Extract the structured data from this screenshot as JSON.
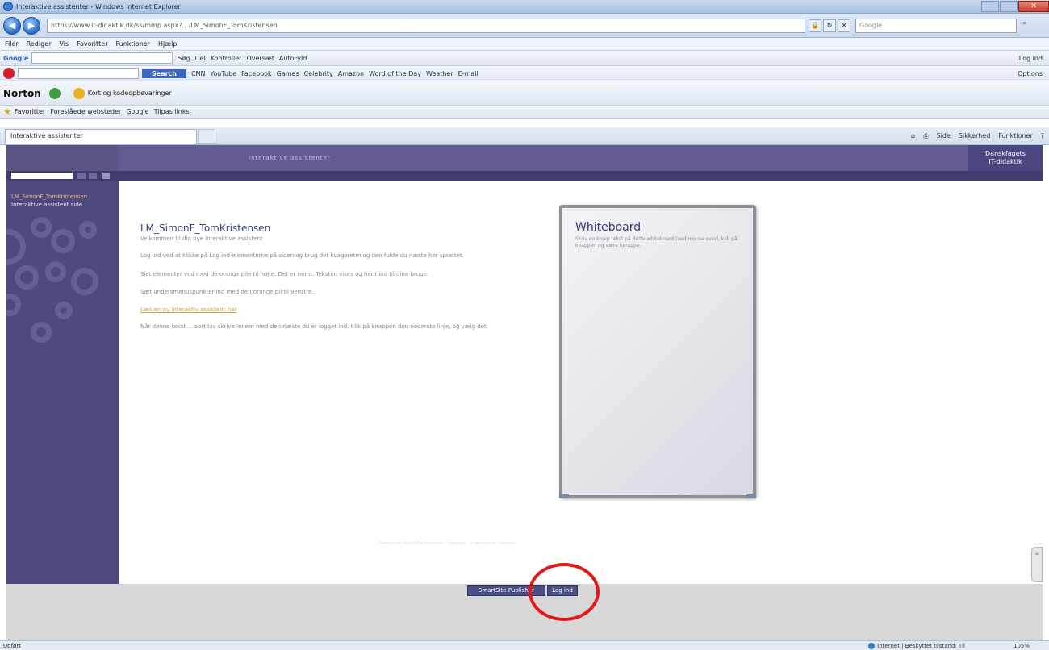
{
  "window": {
    "title": "Interaktive assistenter - Windows Internet Explorer",
    "close_label": "✕"
  },
  "address": {
    "url": "https://www.it-didaktik.dk/ss/mmp.aspx?…/LM_SimonF_TomKristensen",
    "search_placeholder": "Google"
  },
  "menubar": {
    "items": [
      "Filer",
      "Rediger",
      "Vis",
      "Favoritter",
      "Funktioner",
      "Hjælp"
    ]
  },
  "google_toolbar": {
    "logo": "Google",
    "items": [
      "Søg",
      "Del",
      "Kontroller",
      "Oversæt",
      "AutoFyld"
    ],
    "right": "Log ind"
  },
  "ask_toolbar": {
    "search_label": "Search",
    "items": [
      "CNN",
      "YouTube",
      "Facebook",
      "Games",
      "Celebrity",
      "Amazon",
      "Word of the Day",
      "Weather",
      "E-mail"
    ],
    "right": "Options"
  },
  "norton_toolbar": {
    "brand": "Norton",
    "item": "Kort og kodeopbevaringer"
  },
  "favorites_bar": {
    "label": "Favoritter",
    "items": [
      "Foreslåede websteder",
      "Google",
      "Tilpas links"
    ]
  },
  "tabs": {
    "active": "Interaktive assistenter",
    "commands": [
      "Side",
      "Sikkerhed",
      "Funktioner"
    ]
  },
  "page": {
    "banner_crumb": "Interaktive assistenter",
    "brand_line1": "Danskfagets",
    "brand_line2": "IT-didaktik",
    "nav_active": "LM_SimonF_TomKristensen",
    "nav_item2": "Interaktive assistent side",
    "title": "LM_SimonF_TomKristensen",
    "subtitle": "Velkommen til din nye interaktive assistent",
    "paragraphs": [
      "Log ind ved at klikke på Log ind-elementerne på siden og brug det kvageretm og den fulde du næste her sprattet.",
      "Slet elementer ved med de orange pile til højre. Det er nemt. Teksten vises og hent ind til dine bruge.",
      "Sæt undersmenuspunkter ind med den orange pil til venstre."
    ],
    "link": "Læs en ny interaktiv assistent her",
    "closing": "Når denne tekst ... sort lav skrive lenem med den næste du er logget ind. Klik på knappen den nederste linje, og vælg det.",
    "footer_text": "Powered by SmartSite Publisher · Copyright · it-didaktik.dk · Kontakt"
  },
  "whiteboard": {
    "title": "Whiteboard",
    "text": "Skriv en kopip tekst på dette whiteboard (ved mouse over), klik på knappen og være heroppe."
  },
  "footer": {
    "smartsite_label": "SmartSite Publisher",
    "logout_label": "Log ind"
  },
  "side_handle": "«",
  "status": {
    "left": "Udført",
    "zone": "Internet | Beskyttet tilstand: Til",
    "zoom": "105%"
  }
}
